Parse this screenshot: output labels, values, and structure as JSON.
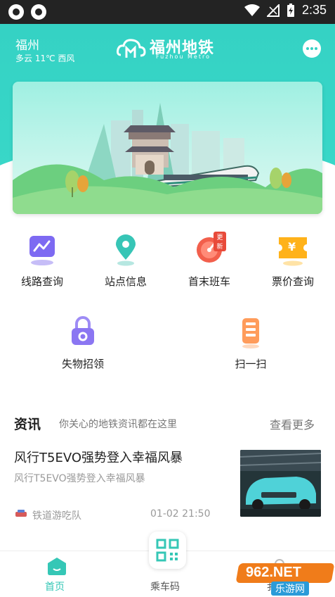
{
  "status_bar": {
    "time": "2:35"
  },
  "header": {
    "city": "福州",
    "weather": "多云 11℃ 西风",
    "logo_name": "福州地铁",
    "logo_en": "Fuzhou Metro"
  },
  "menu": {
    "row1": [
      {
        "label": "线路查询",
        "icon": "line-chart-icon"
      },
      {
        "label": "站点信息",
        "icon": "location-pin-icon"
      },
      {
        "label": "首末班车",
        "icon": "speedometer-icon",
        "badge": "更新"
      },
      {
        "label": "票价查询",
        "icon": "ticket-yen-icon",
        "symbol": "¥"
      }
    ],
    "row2": [
      {
        "label": "失物招领",
        "icon": "lock-bag-icon"
      },
      {
        "label": "扫一扫",
        "icon": "scan-phone-icon"
      }
    ]
  },
  "news": {
    "title": "资讯",
    "subtitle": "你关心的地铁资讯都在这里",
    "more": "查看更多",
    "article": {
      "title": "风行T5EVO强势登入幸福风暴",
      "desc": "风行T5EVO强势登入幸福风暴",
      "source": "铁道游吃队",
      "time": "01-02 21:50"
    }
  },
  "bottom_nav": {
    "home": "首页",
    "qr": "乘车码",
    "mine": "我的"
  },
  "watermark": {
    "text": "962.NET",
    "sub": "乐游网"
  },
  "colors": {
    "accent": "#35d2c4",
    "nav_active": "#35c7b6"
  }
}
